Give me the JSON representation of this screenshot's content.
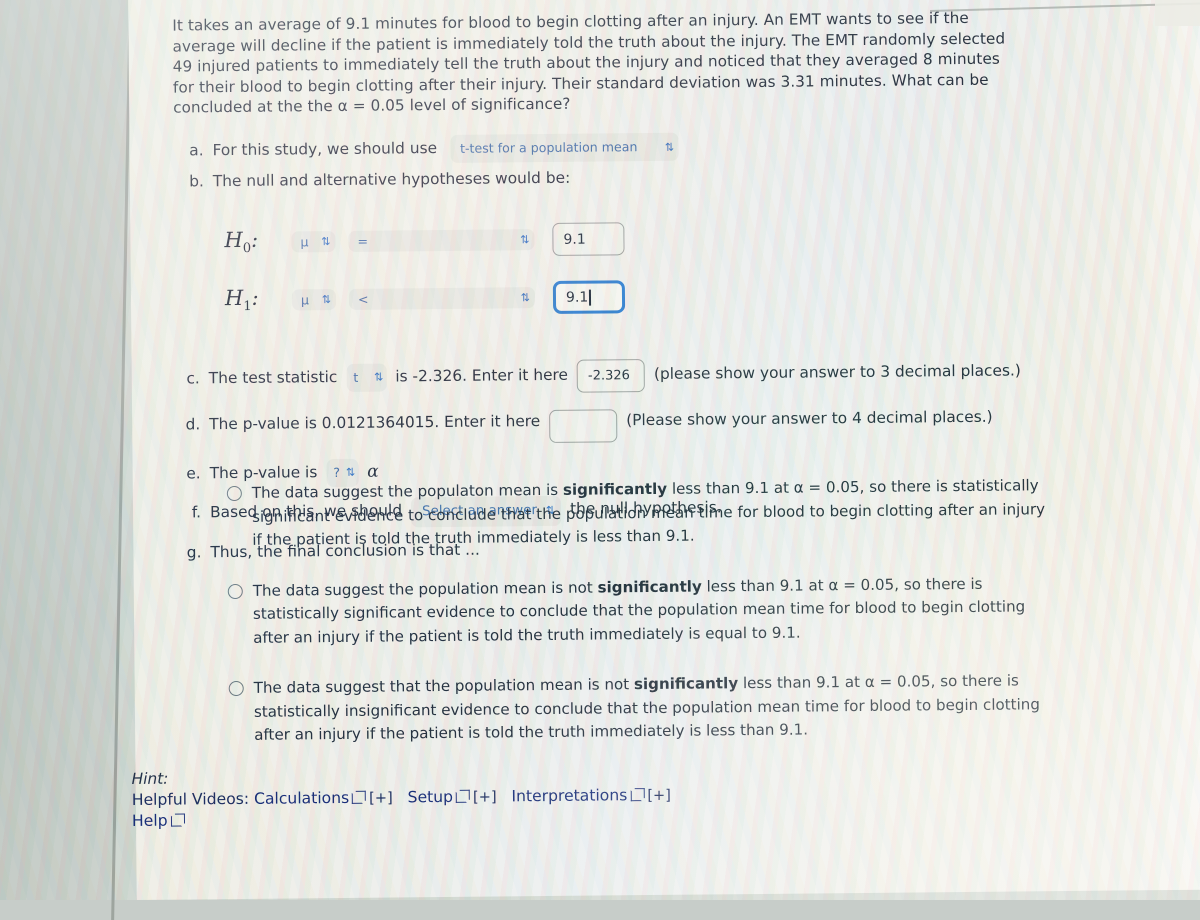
{
  "problem": {
    "lines": [
      "It takes an average of 9.1 minutes for blood to begin clotting after an injury.  An EMT wants to see if the",
      "average will decline if the patient is immediately told the truth about the injury. The EMT randomly selected",
      "49 injured patients to immediately tell the truth about the injury and noticed that they averaged 8 minutes",
      "for their blood to begin clotting after their injury. Their standard deviation was 3.31 minutes. What can be",
      "concluded at the the α = 0.05 level of significance?"
    ]
  },
  "parts": {
    "a": {
      "label": "a.",
      "text": "For this study, we should use",
      "select_value": "t-test for a population mean",
      "chevron": "⇅"
    },
    "b": {
      "label": "b.",
      "text": "The null and alternative hypotheses would be:",
      "h0": {
        "symbol_base": "H",
        "symbol_sub": "0",
        "colon": ":",
        "param": "μ",
        "operator": "=",
        "value": "9.1"
      },
      "h1": {
        "symbol_base": "H",
        "symbol_sub": "1",
        "colon": ":",
        "param": "μ",
        "operator": "<",
        "value": "9.1"
      }
    },
    "c": {
      "label": "c.",
      "text_before": "The test statistic",
      "stat_select": "t",
      "text_mid": "is -2.326. Enter it here",
      "input_value": "-2.326",
      "text_after": "(please show your answer to 3 decimal places.)"
    },
    "d": {
      "label": "d.",
      "text_before": "The p-value is 0.0121364015. Enter it here",
      "input_value": "",
      "text_after": "(Please show your answer to 4 decimal places.)"
    },
    "e": {
      "label": "e.",
      "text_before": "The p-value is",
      "compare_select": "?",
      "text_after": "α"
    },
    "f": {
      "label": "f.",
      "text_before": "Based on this, we should",
      "select_value": "Select an answer",
      "text_after": "the null hypothesis."
    },
    "g": {
      "label": "g.",
      "text": "Thus, the final conclusion is that ..."
    }
  },
  "options": [
    {
      "segments": [
        {
          "t": "The data suggest the populaton mean is ",
          "b": false
        },
        {
          "t": "significantly",
          "b": true
        },
        {
          "t": " less than 9.1 at α = 0.05, so there is statistically significant evidence to conclude that the population mean time for blood to begin clotting after an injury if the patient is told the truth immediately is less than 9.1.",
          "b": false
        }
      ],
      "selected": false
    },
    {
      "segments": [
        {
          "t": "The data suggest the population mean is not ",
          "b": false
        },
        {
          "t": "significantly",
          "b": true
        },
        {
          "t": " less than 9.1 at α = 0.05, so there is statistically significant evidence to conclude that the population mean time for blood to begin clotting after an injury if the patient is told the truth immediately is equal to 9.1.",
          "b": false
        }
      ],
      "selected": false
    },
    {
      "segments": [
        {
          "t": "The data suggest that the population mean is not ",
          "b": false
        },
        {
          "t": "significantly",
          "b": true
        },
        {
          "t": " less than 9.1 at α = 0.05, so there is statistically insignificant evidence to conclude that the population mean time for blood to begin clotting after an injury if the patient is told the truth immediately is less than 9.1.",
          "b": false
        }
      ],
      "selected": false
    }
  ],
  "hint": {
    "title": "Hint:",
    "videos_label": "Helpful Videos:",
    "links": [
      {
        "label": "Calculations",
        "plus": "[+]"
      },
      {
        "label": "Setup",
        "plus": "[+]"
      },
      {
        "label": "Interpretations",
        "plus": "[+]"
      }
    ],
    "help_label": "Help"
  },
  "colors": {
    "link": "#1a2f7a",
    "focus_border": "#2f7fd0",
    "select_text": "#3f6ea8",
    "body_text": "#26303e"
  }
}
